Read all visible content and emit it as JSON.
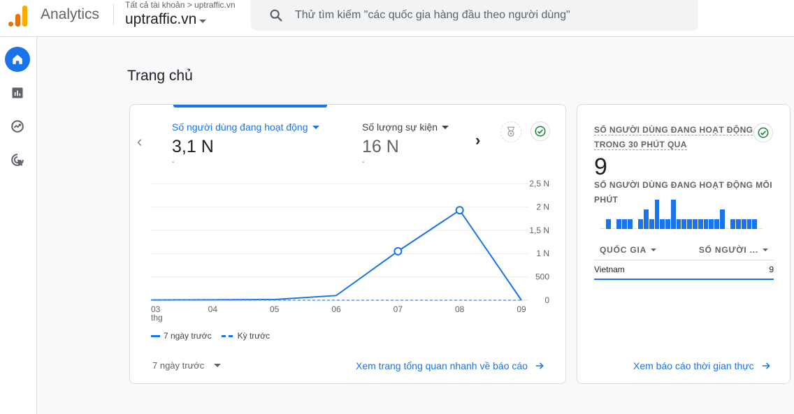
{
  "header": {
    "app_name": "Analytics",
    "breadcrumb": "Tất cả tài khoản > uptraffic.vn",
    "property": "uptraffic.vn",
    "search_placeholder": "Thử tìm kiếm \"các quốc gia hàng đầu theo người dùng\""
  },
  "sidebar": {
    "items": [
      {
        "name": "home",
        "icon": "home-icon",
        "active": true
      },
      {
        "name": "reports",
        "icon": "bar-chart-icon",
        "active": false
      },
      {
        "name": "explore",
        "icon": "explore-icon",
        "active": false
      },
      {
        "name": "advertising",
        "icon": "target-cursor-icon",
        "active": false
      }
    ]
  },
  "page_title": "Trang chủ",
  "overview_card": {
    "metrics": [
      {
        "label": "Số người dùng đang hoạt động",
        "value": "3,1 N",
        "sub": "-",
        "selected": true
      },
      {
        "label": "Số lượng sự kiện",
        "value": "16 N",
        "sub": "-",
        "selected": false
      }
    ],
    "legend": {
      "current": "7 ngày trước",
      "previous": "Kỳ trước"
    },
    "period_select": "7 ngày trước",
    "link": "Xem trang tổng quan nhanh về báo cáo"
  },
  "chart_data": {
    "type": "line",
    "title": "",
    "xlabel": "",
    "ylabel": "",
    "x": [
      "03 thg",
      "04",
      "05",
      "06",
      "07",
      "08",
      "09"
    ],
    "y_ticks": [
      "0",
      "500",
      "1 N",
      "1,5 N",
      "2 N",
      "2,5 N"
    ],
    "ylim": [
      0,
      2500
    ],
    "grid": true,
    "legend_position": "bottom-left",
    "series": [
      {
        "name": "7 ngày trước",
        "style": "solid",
        "values": [
          5,
          10,
          15,
          100,
          1050,
          1930,
          0
        ]
      },
      {
        "name": "Kỳ trước",
        "style": "dashed",
        "values": [
          0,
          0,
          0,
          0,
          0,
          0,
          0
        ]
      }
    ],
    "marked_points": [
      4,
      5
    ]
  },
  "realtime_card": {
    "title_line1": "SỐ NGƯỜI DÙNG ĐANG HOẠT ĐỘNG",
    "title_line2": "TRONG 30 PHÚT QUA",
    "value": "9",
    "per_minute_label": "SỐ NGƯỜI DÙNG ĐANG HOẠT ĐỘNG MỖI PHÚT",
    "per_minute_values": [
      0,
      1,
      0,
      1,
      1,
      1,
      0,
      1,
      2,
      1,
      3,
      1,
      1,
      3,
      1,
      1,
      1,
      1,
      1,
      1,
      1,
      1,
      2,
      0,
      1,
      1,
      1,
      1,
      1,
      0
    ],
    "table": {
      "headers": [
        "QUỐC GIA",
        "SỐ NGƯỜI ..."
      ],
      "rows": [
        {
          "country": "Vietnam",
          "users": "9",
          "share": 1.0
        }
      ]
    },
    "link": "Xem báo cáo thời gian thực"
  },
  "colors": {
    "accent": "#1a73e8",
    "success": "#188038",
    "logo_orange": "#e37400",
    "logo_yellow": "#f9ab00"
  }
}
